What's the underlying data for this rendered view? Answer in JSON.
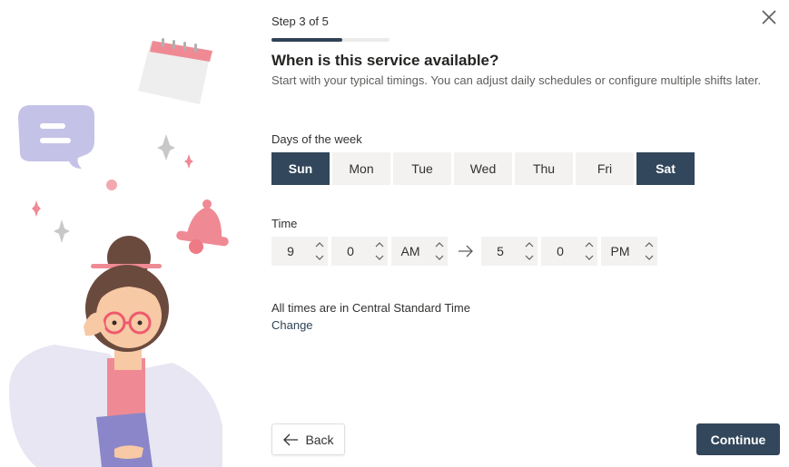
{
  "wizard": {
    "step_label": "Step 3 of 5",
    "progress": 0.6,
    "title": "When is this service available?",
    "subtitle": "Start with your typical timings. You can adjust daily schedules or configure multiple shifts later."
  },
  "days": {
    "label": "Days of the week",
    "items": [
      {
        "label": "Sun",
        "selected": true
      },
      {
        "label": "Mon",
        "selected": false
      },
      {
        "label": "Tue",
        "selected": false
      },
      {
        "label": "Wed",
        "selected": false
      },
      {
        "label": "Thu",
        "selected": false
      },
      {
        "label": "Fri",
        "selected": false
      },
      {
        "label": "Sat",
        "selected": true
      }
    ]
  },
  "time": {
    "label": "Time",
    "start": {
      "hour": "9",
      "minute": "0",
      "period": "AM"
    },
    "end": {
      "hour": "5",
      "minute": "0",
      "period": "PM"
    }
  },
  "timezone": {
    "text": "All times are in Central Standard Time",
    "change_label": "Change"
  },
  "footer": {
    "back_label": "Back",
    "continue_label": "Continue"
  },
  "colors": {
    "accent": "#32475b",
    "selected_day_bg": "#32475b",
    "unselected_day_bg": "#f3f2f1"
  },
  "icons": {
    "close": "close-icon",
    "back": "arrow-left-icon",
    "time_separator": "arrow-right-icon",
    "spin_up": "chevron-up-icon",
    "spin_down": "chevron-down-icon"
  }
}
